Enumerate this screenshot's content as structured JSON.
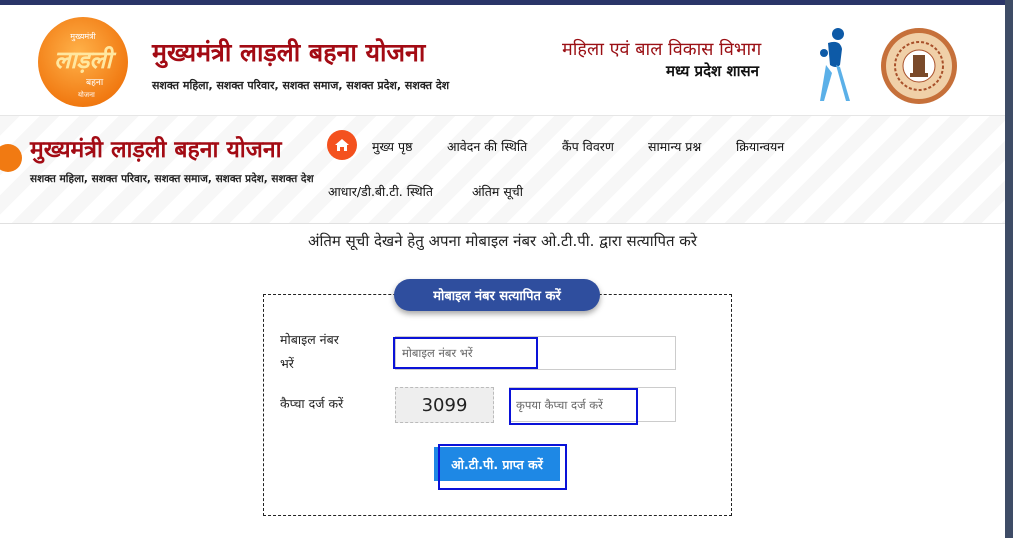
{
  "header": {
    "logo": {
      "line1": "मुख्यमंत्री",
      "line2": "लाड़ली",
      "line3": "बहना",
      "line4": "योजना"
    },
    "title": "मुख्यमंत्री लाड़ली बहना योजना",
    "subtitle": "सशक्त महिला, सशक्त परिवार, सशक्त समाज, सशक्त प्रदेश, सशक्त देश",
    "department": "महिला एवं बाल विकास विभाग",
    "government": "मध्य प्रदेश शासन",
    "emblem_icon": "mp-government-seal"
  },
  "nav": {
    "title": "मुख्यमंत्री लाड़ली बहना योजना",
    "subtitle": "सशक्त महिला, सशक्त परिवार, सशक्त समाज, सशक्त प्रदेश, सशक्त देश",
    "home_icon": "home-icon",
    "items": [
      "मुख्य पृष्ठ",
      "आवेदन की स्थिति",
      "कैंप विवरण",
      "सामान्य प्रश्न",
      "क्रियान्वयन",
      "आधार/डी.बी.टी. स्थिति",
      "अंतिम सूची"
    ]
  },
  "main": {
    "instruction": "अंतिम सूची देखने हेतु अपना मोबाइल नंबर ओ.टी.पी. द्वारा सत्यापित करे",
    "form": {
      "legend": "मोबाइल नंबर सत्यापित करें",
      "mobile_label_1": "मोबाइल नंबर",
      "mobile_label_2": "भरें",
      "mobile_placeholder": "मोबाइल नंबर भरें",
      "captcha_label": "कैप्चा दर्ज करें",
      "captcha_value": "3099",
      "captcha_placeholder": "कृपया कैप्चा दर्ज करें",
      "submit_label": "ओ.टी.पी. प्राप्त करें"
    }
  },
  "colors": {
    "title_red": "#a30b14",
    "brand_orange": "#f17a12",
    "legend_blue": "#2f4e9e",
    "button_blue": "#1e88e5",
    "highlight_blue": "#0a12d8",
    "home_orange": "#f4511e"
  }
}
